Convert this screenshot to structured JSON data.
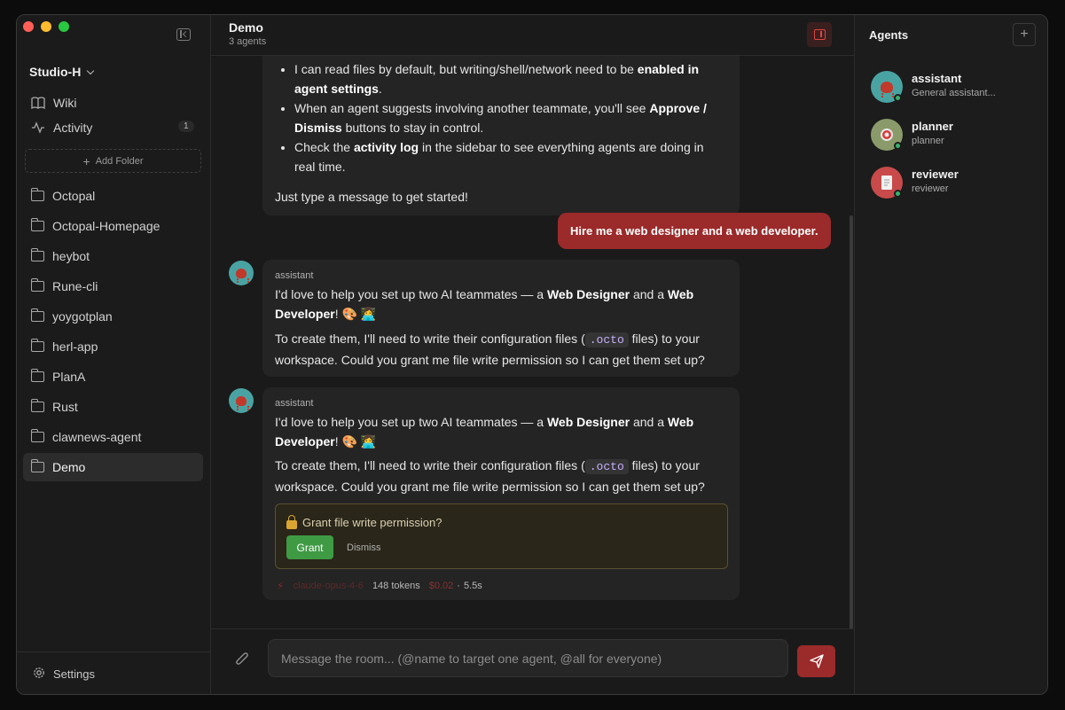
{
  "sidebar": {
    "workspace": "Studio-H",
    "nav": [
      {
        "label": "Wiki",
        "icon": "book-icon"
      },
      {
        "label": "Activity",
        "icon": "activity-icon",
        "badge": "1"
      }
    ],
    "add_folder": "Add Folder",
    "folders": [
      "Octopal",
      "Octopal-Homepage",
      "heybot",
      "Rune-cli",
      "yoygotplan",
      "herl-app",
      "PlanA",
      "Rust",
      "clawnews-agent",
      "Demo"
    ],
    "active_folder": "Demo",
    "settings": "Settings"
  },
  "room": {
    "title": "Demo",
    "subtitle": "3 agents"
  },
  "intro": {
    "bullet_partial_1": "I can read files by default, but writing/shell/network need to be ",
    "bullet_partial_1_bold": "enabled in agent settings",
    "bullet_2_a": "When an agent suggests involving another teammate, you'll see ",
    "bullet_2_bold": "Approve / Dismiss",
    "bullet_2_b": " buttons to stay in control.",
    "bullet_3_a": "Check the ",
    "bullet_3_bold": "activity log",
    "bullet_3_b": " in the sidebar to see everything agents are doing in real time.",
    "closing": "Just type a message to get started!"
  },
  "user_message": "Hire me a web designer and a web developer.",
  "messages": [
    {
      "sender": "assistant",
      "line1_a": "I'd love to help you set up two AI teammates — a ",
      "designer": "Web Designer",
      "and": " and a ",
      "developer": "Web Developer",
      "emoji": "! 🎨 👩‍💻",
      "line2_a": "To create them, I'll need to write their configuration files (",
      "code": ".octo",
      "line2_b": " files) to your workspace. Could you grant me file write permission so I can get them set up?"
    },
    {
      "sender": "assistant",
      "line1_a": "I'd love to help you set up two AI teammates — a ",
      "designer": "Web Designer",
      "and": " and a ",
      "developer": "Web Developer",
      "emoji": "! 🎨 👩‍💻",
      "line2_a": "To create them, I'll need to write their configuration files (",
      "code": ".octo",
      "line2_b": " files) to your workspace. Could you grant me file write permission so I can get them set up?",
      "permission": {
        "title": "Grant file write permission?",
        "grant": "Grant",
        "dismiss": "Dismiss"
      },
      "meta": {
        "model": "claude-opus-4-6",
        "tokens": "148 tokens",
        "cost": "$0.02",
        "sep": "·",
        "time": "5.5s"
      }
    }
  ],
  "composer": {
    "placeholder": "Message the room... (@name to target one agent, @all for everyone)"
  },
  "agents_panel": {
    "title": "Agents",
    "agents": [
      {
        "name": "assistant",
        "desc": "General assistant...",
        "color": "#4aa3a3",
        "icon": "octopus-icon"
      },
      {
        "name": "planner",
        "desc": "planner",
        "color": "#8a9a6a",
        "icon": "target-icon"
      },
      {
        "name": "reviewer",
        "desc": "reviewer",
        "color": "#c84a4a",
        "icon": "memo-icon"
      }
    ]
  }
}
